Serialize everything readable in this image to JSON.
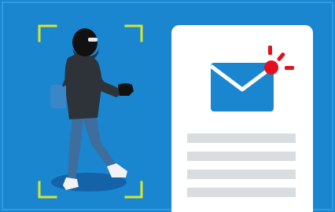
{
  "scene": {
    "background_color": "#1A86D0",
    "border_color": "#2F9BE3",
    "frame_color": "#D6E62B",
    "figure": {
      "description_icon": "hooded-burglar-icon",
      "mask_color": "#111111",
      "hoodie_color": "#2D3338",
      "jeans_color": "#3D6E9E",
      "shoe_color": "#F2F2F2",
      "bag_color": "#3A86C7",
      "shadow_color": "#1463A8"
    },
    "document": {
      "icon": "document-icon",
      "paper_color": "#FFFFFF",
      "line_color": "#DADDE0",
      "line_count": 4,
      "email": {
        "icon": "envelope-icon",
        "color": "#1A86D0",
        "flap_color": "#FFFFFF"
      },
      "alert": {
        "icon": "notification-alert-icon",
        "color": "#E3101E"
      }
    }
  }
}
